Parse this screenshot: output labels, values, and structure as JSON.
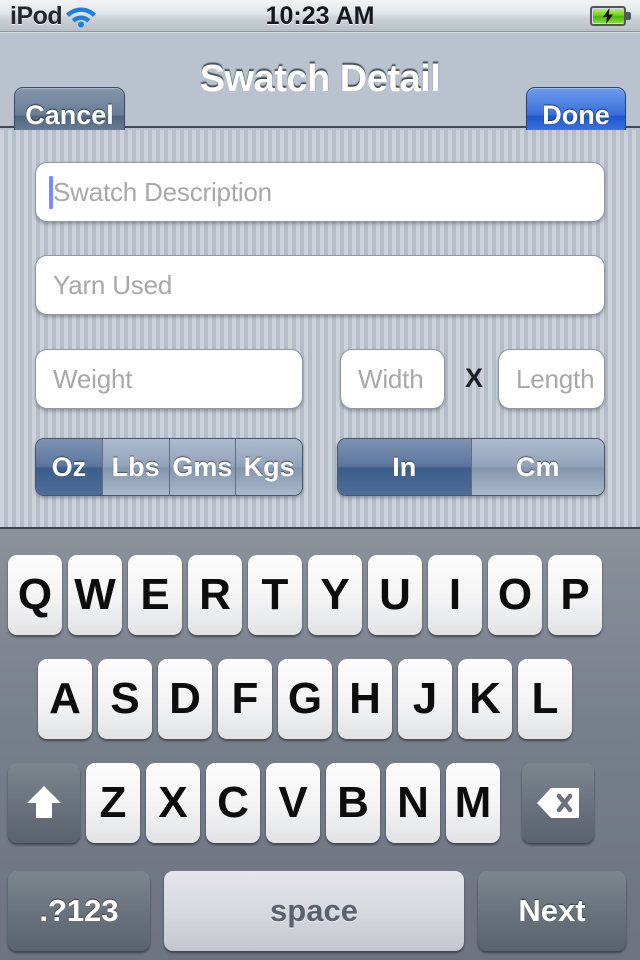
{
  "status_bar": {
    "carrier": "iPod",
    "wifi_icon": "wifi-icon",
    "time": "10:23 AM",
    "battery_icon": "battery-charging-icon"
  },
  "nav_bar": {
    "cancel_label": "Cancel",
    "title": "Swatch Detail",
    "done_label": "Done",
    "done_color": "#2f66d6"
  },
  "form": {
    "description_placeholder": "Swatch Description",
    "description_value": "",
    "yarn_placeholder": "Yarn Used",
    "yarn_value": "",
    "weight_placeholder": "Weight",
    "weight_value": "",
    "width_placeholder": "Width",
    "width_value": "",
    "separator": "X",
    "length_placeholder": "Length",
    "length_value": "",
    "weight_units": [
      {
        "label": "Oz",
        "selected": true
      },
      {
        "label": "Lbs",
        "selected": false
      },
      {
        "label": "Gms",
        "selected": false
      },
      {
        "label": "Kgs",
        "selected": false
      }
    ],
    "length_units": [
      {
        "label": "In",
        "selected": true
      },
      {
        "label": "Cm",
        "selected": false
      }
    ],
    "selected_color": "#3d5d8c"
  },
  "keyboard": {
    "row1": [
      "Q",
      "W",
      "E",
      "R",
      "T",
      "Y",
      "U",
      "I",
      "O",
      "P"
    ],
    "row2": [
      "A",
      "S",
      "D",
      "F",
      "G",
      "H",
      "J",
      "K",
      "L"
    ],
    "row3": [
      "Z",
      "X",
      "C",
      "V",
      "B",
      "N",
      "M"
    ],
    "shift_icon": "shift-arrow-icon",
    "backspace_icon": "backspace-icon",
    "numeric_label": ".?123",
    "space_label": "space",
    "return_label": "Next"
  }
}
